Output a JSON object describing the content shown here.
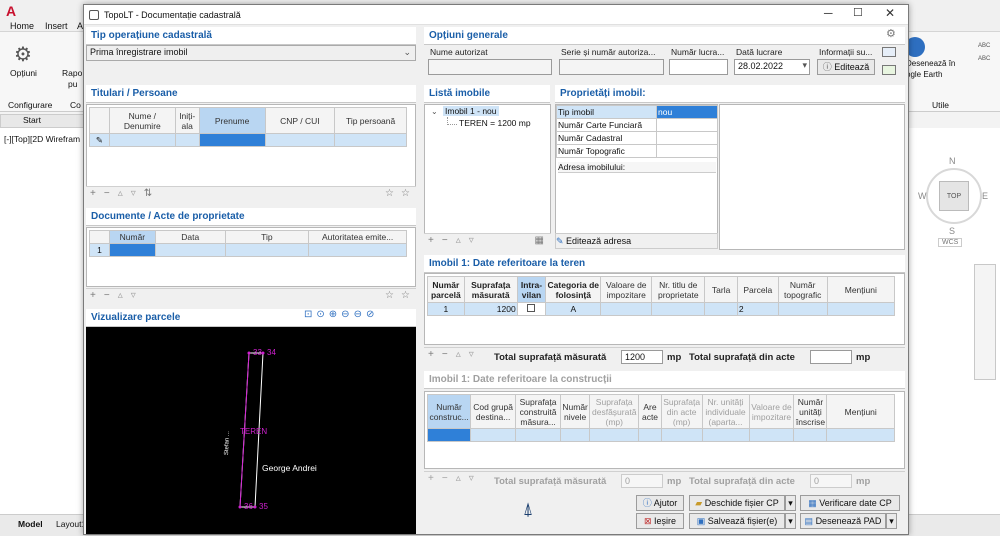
{
  "background": {
    "app_logo": "A",
    "tabs": [
      "Home",
      "Insert",
      "A"
    ],
    "ribbon": {
      "optiuni": "Opțiuni",
      "configurare": "Configurare",
      "rapoarte": "Rapo",
      "rapoarte2": "pu",
      "co": "Co",
      "deseneaza": "Desenează în",
      "google": "ogle Earth",
      "utile": "Utile",
      "abc1": "ABC",
      "abc2": "ABC"
    },
    "start_tab": "Start",
    "viewport_label": "[-][Top][2D Wirefram",
    "viewcube": {
      "n": "N",
      "s": "S",
      "w": "W",
      "e": "E",
      "top": "TOP",
      "wcs": "WCS"
    },
    "layout_tabs": [
      "Model",
      "Layout1"
    ]
  },
  "dialog": {
    "title": "TopoLT - Documentație cadastrală",
    "tip_operatiune": {
      "title": "Tip operațiune cadastrală",
      "value": "Prima înregistrare imobil"
    },
    "titulari": {
      "title": "Titulari / Persoane",
      "headers": [
        "Nume / Denumire",
        "Iniți-ala",
        "Prenume",
        "CNP / CUI",
        "Tip persoană"
      ]
    },
    "documente": {
      "title": "Documente / Acte de proprietate",
      "headers": [
        "Număr",
        "Data",
        "Tip",
        "Autoritatea emite..."
      ],
      "row_num": "1"
    },
    "vizualizare": {
      "title": "Vizualizare parcele",
      "labels": {
        "p33": "33",
        "p34": "34",
        "p36": "36",
        "p35": "35",
        "teren": "TEREN",
        "owner": "George Andrei",
        "road": "Stefan ..."
      }
    },
    "optiuni": {
      "title": "Opțiuni generale",
      "nume_autorizat": "Nume autorizat",
      "serie": "Serie și număr autoriza...",
      "numar_lucrare": "Număr lucra...",
      "data_lucrare": "Dată lucrare",
      "data_value": "28.02.2022",
      "informatii": "Informații su...",
      "editeaza": "Editează"
    },
    "lista": {
      "title": "Listă imobile",
      "imobil": "Imobil 1 - nou",
      "teren": "TEREN = 1200 mp"
    },
    "proprietati": {
      "title": "Proprietăți imobil:",
      "rows": [
        {
          "k": "Tip imobil",
          "v": "nou"
        },
        {
          "k": "Număr Carte Funciară",
          "v": ""
        },
        {
          "k": "Număr Cadastral",
          "v": ""
        },
        {
          "k": "Număr Topografic",
          "v": ""
        }
      ],
      "adresa": "Adresa imobilului:",
      "editeaza_adresa": "Editează adresa"
    },
    "teren": {
      "title": "Imobil 1: Date referitoare la teren",
      "headers": [
        "Număr parcelă",
        "Suprafața măsurată",
        "Intra-vilan",
        "Categoria de folosință",
        "Valoare de impozitare",
        "Nr. titlu de proprietate",
        "Tarla",
        "Parcela",
        "Număr topografic",
        "Mențiuni"
      ],
      "row": {
        "nr": "1",
        "supr": "1200",
        "cat": "A",
        "parcela": "2"
      },
      "total_masurata": "Total suprafață măsurată",
      "total_value": "1200",
      "mp": "mp",
      "total_acte": "Total suprafață din acte",
      "mp2": "mp"
    },
    "constructii": {
      "title": "Imobil 1: Date referitoare la construcții",
      "headers": [
        "Număr construc...",
        "Cod grupă destina...",
        "Suprafața construită măsura...",
        "Număr nivele",
        "Suprafața desfășurată (mp)",
        "Are acte",
        "Suprafața din acte (mp)",
        "Nr. unități individuale (aparta...",
        "Valoare de impozitare",
        "Număr unități înscrise",
        "Mențiuni"
      ],
      "total_masurata": "Total suprafață măsurată",
      "zero1": "0",
      "mp": "mp",
      "total_acte": "Total suprafață din acte",
      "zero2": "0",
      "mp2": "mp"
    },
    "buttons": {
      "ajutor": "Ajutor",
      "iesire": "Ieșire",
      "deschide": "Deschide fișier CP",
      "salveaza": "Salvează fișier(e)",
      "verificare": "Verificare date CP",
      "deseneaza": "Desenează PAD"
    }
  }
}
